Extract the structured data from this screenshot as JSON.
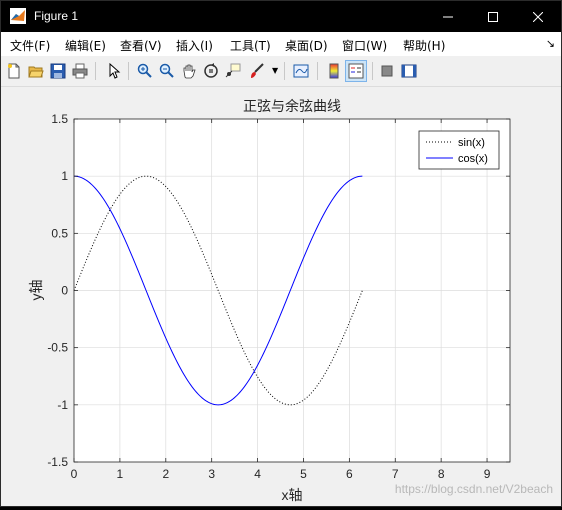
{
  "window": {
    "title": "Figure 1",
    "min_icon": "minimize-icon",
    "max_icon": "maximize-icon",
    "close_icon": "close-icon"
  },
  "menu": [
    {
      "label": "文件(F)"
    },
    {
      "label": "编辑(E)"
    },
    {
      "label": "查看(V)"
    },
    {
      "label": "插入(I)"
    },
    {
      "label": "工具(T)"
    },
    {
      "label": "桌面(D)"
    },
    {
      "label": "窗口(W)"
    },
    {
      "label": "帮助(H)"
    }
  ],
  "toolbar": [
    {
      "name": "new-figure-icon"
    },
    {
      "name": "open-file-icon"
    },
    {
      "name": "save-icon"
    },
    {
      "name": "print-icon"
    },
    {
      "name": "edit-plot-icon"
    },
    {
      "name": "zoom-in-icon"
    },
    {
      "name": "zoom-out-icon"
    },
    {
      "name": "pan-icon"
    },
    {
      "name": "rotate-3d-icon"
    },
    {
      "name": "data-cursor-icon"
    },
    {
      "name": "brush-icon"
    },
    {
      "name": "link-plot-icon"
    },
    {
      "name": "colorbar-icon"
    },
    {
      "name": "legend-icon"
    },
    {
      "name": "hide-plot-tools-icon"
    },
    {
      "name": "show-plot-tools-icon"
    }
  ],
  "colors": {
    "sin": "#000000",
    "cos": "#0000ff",
    "grid": "#dcdcdc",
    "axes_bg": "#ffffff",
    "figure_bg": "#f0f0f0"
  },
  "watermark": "https://blog.csdn.net/V2beach",
  "chart_data": {
    "type": "line",
    "title": "正弦与余弦曲线",
    "xlabel": "x轴",
    "ylabel": "y轴",
    "xlim": [
      0,
      9.5
    ],
    "ylim": [
      -1.5,
      1.5
    ],
    "xticks": [
      "0",
      "1",
      "2",
      "3",
      "4",
      "5",
      "6",
      "7",
      "8",
      "9"
    ],
    "yticks": [
      "1.5",
      "1",
      "0.5",
      "0",
      "-0.5",
      "-1",
      "-1.5"
    ],
    "grid": true,
    "legend_position": "top-right",
    "x_range": [
      0,
      6.2832
    ],
    "series": [
      {
        "name": "sin(x)",
        "function": "sin",
        "style": "dotted",
        "color": "#000000"
      },
      {
        "name": "cos(x)",
        "function": "cos",
        "style": "solid",
        "color": "#0000ff"
      }
    ]
  }
}
